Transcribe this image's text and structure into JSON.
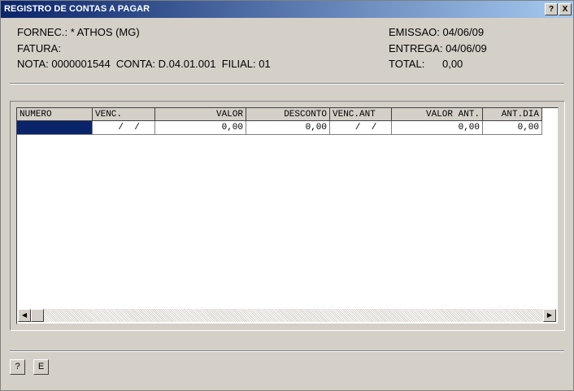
{
  "window": {
    "title": "REGISTRO DE CONTAS A PAGAR",
    "help_button": "?",
    "close_button": "X"
  },
  "info": {
    "fornec": "FORNEC.: * ATHOS (MG)",
    "fatura": "FATURA:",
    "nota_line": "NOTA: 0000001544  CONTA: D.04.01.001  FILIAL: 01",
    "emissao": "EMISSAO: 04/06/09",
    "entrega": "ENTREGA: 04/06/09",
    "total": "TOTAL:      0,00"
  },
  "grid": {
    "columns": [
      "NUMERO",
      "VENC.",
      "VALOR",
      "DESCONTO",
      "VENC.ANT",
      "VALOR ANT.",
      "ANT.DIA"
    ],
    "rows": [
      {
        "numero": "",
        "venc": "  /  /",
        "valor": "0,00",
        "desconto": "0,00",
        "venc_ant": "  /  /",
        "valor_ant": "0,00",
        "ant_dia": "0,00"
      }
    ],
    "selection_color": "#0a246a"
  },
  "scrollbar": {
    "left_arrow_icon": "left-arrow-icon",
    "right_arrow_icon": "right-arrow-icon"
  },
  "footer": {
    "help_label": "?",
    "e_label": "E"
  }
}
